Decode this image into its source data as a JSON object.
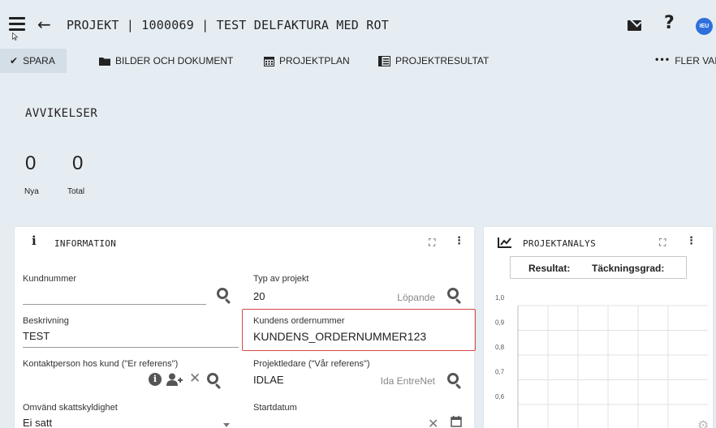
{
  "header": {
    "title": "PROJEKT | 1000069 | TEST DELFAKTURA MED ROT",
    "avatar_initials": "IEU",
    "help_symbol": "?",
    "icons": [
      "menu-icon",
      "back-arrow-icon",
      "mail-icon",
      "help-icon"
    ]
  },
  "toolbar": {
    "save": "SPARA",
    "images_docs": "BILDER OCH DOKUMENT",
    "project_plan": "PROJEKTPLAN",
    "project_result": "PROJEKTRESULTAT",
    "more": "FLER VAL"
  },
  "deviations": {
    "title": "AVVIKELSER",
    "new_count": "0",
    "new_label": "Nya",
    "total_count": "0",
    "total_label": "Total"
  },
  "info_card": {
    "title": "INFORMATION",
    "fields": {
      "customer_number": {
        "label": "Kundnummer",
        "value": ""
      },
      "project_type": {
        "label": "Typ av projekt",
        "value": "20",
        "hint": "Löpande"
      },
      "description": {
        "label": "Beskrivning",
        "value": "TEST"
      },
      "customer_order_number": {
        "label": "Kundens ordernummer",
        "value": "KUNDENS_ORDERNUMMER123"
      },
      "contact_person": {
        "label": "Kontaktperson hos kund (\"Er referens\")",
        "value": ""
      },
      "project_manager": {
        "label": "Projektledare (\"Vår referens\")",
        "value": "IDLAE",
        "hint": "Ida EntreNet"
      },
      "reverse_vat": {
        "label": "Omvänd skattskyldighet",
        "value": "Ei satt"
      },
      "start_date": {
        "label": "Startdatum",
        "value": ""
      }
    },
    "highlight_color": "#d94848"
  },
  "analysis_card": {
    "title": "PROJEKTANALYS",
    "legend": [
      "Resultat:",
      "Täckningsgrad:"
    ],
    "y_ticks": [
      "1,0",
      "0,9",
      "0,8",
      "0,7",
      "0,6"
    ]
  },
  "chart_data": {
    "type": "line",
    "title": "",
    "series": [],
    "ylim": [
      0.6,
      1.0
    ],
    "y_ticks": [
      "1,0",
      "0,9",
      "0,8",
      "0,7",
      "0,6"
    ],
    "grid": true
  },
  "colors": {
    "background": "#e6edf2",
    "card": "#ffffff",
    "accent_avatar": "#2e6fdc",
    "active_tab_bg": "#d4dee6"
  }
}
